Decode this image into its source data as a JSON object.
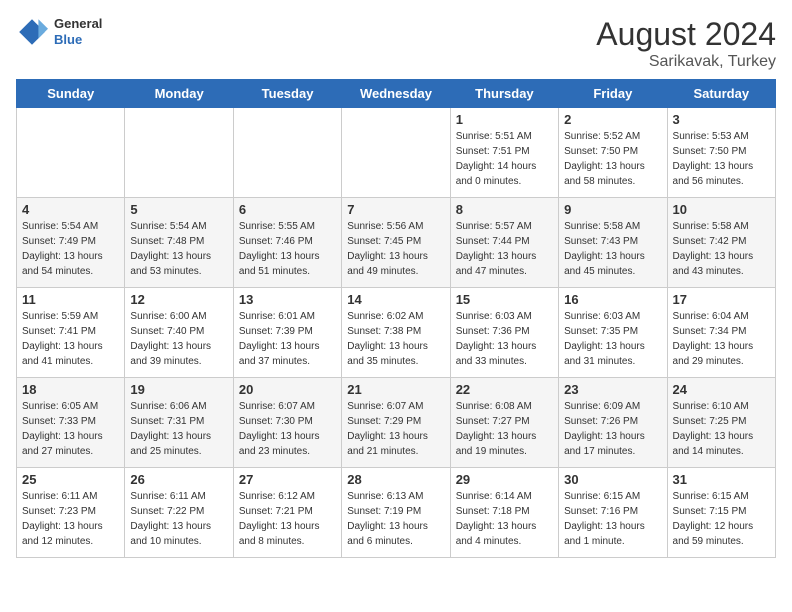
{
  "header": {
    "logo_general": "General",
    "logo_blue": "Blue",
    "title": "August 2024",
    "subtitle": "Sarikavak, Turkey"
  },
  "weekdays": [
    "Sunday",
    "Monday",
    "Tuesday",
    "Wednesday",
    "Thursday",
    "Friday",
    "Saturday"
  ],
  "weeks": [
    [
      {
        "day": "",
        "info": ""
      },
      {
        "day": "",
        "info": ""
      },
      {
        "day": "",
        "info": ""
      },
      {
        "day": "",
        "info": ""
      },
      {
        "day": "1",
        "info": "Sunrise: 5:51 AM\nSunset: 7:51 PM\nDaylight: 14 hours\nand 0 minutes."
      },
      {
        "day": "2",
        "info": "Sunrise: 5:52 AM\nSunset: 7:50 PM\nDaylight: 13 hours\nand 58 minutes."
      },
      {
        "day": "3",
        "info": "Sunrise: 5:53 AM\nSunset: 7:50 PM\nDaylight: 13 hours\nand 56 minutes."
      }
    ],
    [
      {
        "day": "4",
        "info": "Sunrise: 5:54 AM\nSunset: 7:49 PM\nDaylight: 13 hours\nand 54 minutes."
      },
      {
        "day": "5",
        "info": "Sunrise: 5:54 AM\nSunset: 7:48 PM\nDaylight: 13 hours\nand 53 minutes."
      },
      {
        "day": "6",
        "info": "Sunrise: 5:55 AM\nSunset: 7:46 PM\nDaylight: 13 hours\nand 51 minutes."
      },
      {
        "day": "7",
        "info": "Sunrise: 5:56 AM\nSunset: 7:45 PM\nDaylight: 13 hours\nand 49 minutes."
      },
      {
        "day": "8",
        "info": "Sunrise: 5:57 AM\nSunset: 7:44 PM\nDaylight: 13 hours\nand 47 minutes."
      },
      {
        "day": "9",
        "info": "Sunrise: 5:58 AM\nSunset: 7:43 PM\nDaylight: 13 hours\nand 45 minutes."
      },
      {
        "day": "10",
        "info": "Sunrise: 5:58 AM\nSunset: 7:42 PM\nDaylight: 13 hours\nand 43 minutes."
      }
    ],
    [
      {
        "day": "11",
        "info": "Sunrise: 5:59 AM\nSunset: 7:41 PM\nDaylight: 13 hours\nand 41 minutes."
      },
      {
        "day": "12",
        "info": "Sunrise: 6:00 AM\nSunset: 7:40 PM\nDaylight: 13 hours\nand 39 minutes."
      },
      {
        "day": "13",
        "info": "Sunrise: 6:01 AM\nSunset: 7:39 PM\nDaylight: 13 hours\nand 37 minutes."
      },
      {
        "day": "14",
        "info": "Sunrise: 6:02 AM\nSunset: 7:38 PM\nDaylight: 13 hours\nand 35 minutes."
      },
      {
        "day": "15",
        "info": "Sunrise: 6:03 AM\nSunset: 7:36 PM\nDaylight: 13 hours\nand 33 minutes."
      },
      {
        "day": "16",
        "info": "Sunrise: 6:03 AM\nSunset: 7:35 PM\nDaylight: 13 hours\nand 31 minutes."
      },
      {
        "day": "17",
        "info": "Sunrise: 6:04 AM\nSunset: 7:34 PM\nDaylight: 13 hours\nand 29 minutes."
      }
    ],
    [
      {
        "day": "18",
        "info": "Sunrise: 6:05 AM\nSunset: 7:33 PM\nDaylight: 13 hours\nand 27 minutes."
      },
      {
        "day": "19",
        "info": "Sunrise: 6:06 AM\nSunset: 7:31 PM\nDaylight: 13 hours\nand 25 minutes."
      },
      {
        "day": "20",
        "info": "Sunrise: 6:07 AM\nSunset: 7:30 PM\nDaylight: 13 hours\nand 23 minutes."
      },
      {
        "day": "21",
        "info": "Sunrise: 6:07 AM\nSunset: 7:29 PM\nDaylight: 13 hours\nand 21 minutes."
      },
      {
        "day": "22",
        "info": "Sunrise: 6:08 AM\nSunset: 7:27 PM\nDaylight: 13 hours\nand 19 minutes."
      },
      {
        "day": "23",
        "info": "Sunrise: 6:09 AM\nSunset: 7:26 PM\nDaylight: 13 hours\nand 17 minutes."
      },
      {
        "day": "24",
        "info": "Sunrise: 6:10 AM\nSunset: 7:25 PM\nDaylight: 13 hours\nand 14 minutes."
      }
    ],
    [
      {
        "day": "25",
        "info": "Sunrise: 6:11 AM\nSunset: 7:23 PM\nDaylight: 13 hours\nand 12 minutes."
      },
      {
        "day": "26",
        "info": "Sunrise: 6:11 AM\nSunset: 7:22 PM\nDaylight: 13 hours\nand 10 minutes."
      },
      {
        "day": "27",
        "info": "Sunrise: 6:12 AM\nSunset: 7:21 PM\nDaylight: 13 hours\nand 8 minutes."
      },
      {
        "day": "28",
        "info": "Sunrise: 6:13 AM\nSunset: 7:19 PM\nDaylight: 13 hours\nand 6 minutes."
      },
      {
        "day": "29",
        "info": "Sunrise: 6:14 AM\nSunset: 7:18 PM\nDaylight: 13 hours\nand 4 minutes."
      },
      {
        "day": "30",
        "info": "Sunrise: 6:15 AM\nSunset: 7:16 PM\nDaylight: 13 hours\nand 1 minute."
      },
      {
        "day": "31",
        "info": "Sunrise: 6:15 AM\nSunset: 7:15 PM\nDaylight: 12 hours\nand 59 minutes."
      }
    ]
  ]
}
